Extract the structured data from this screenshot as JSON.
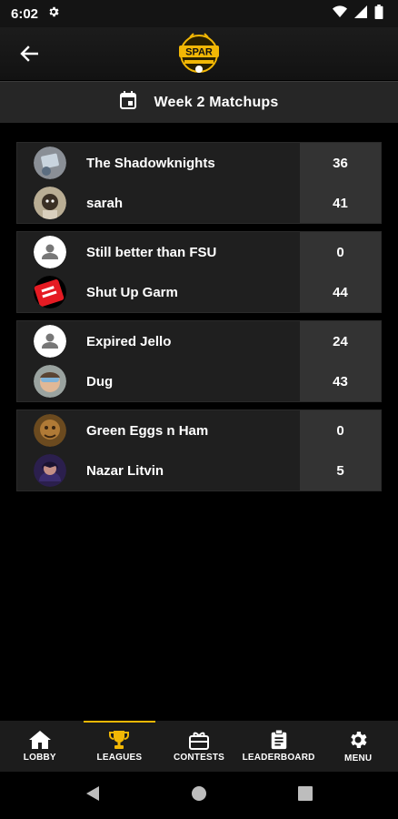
{
  "status_bar": {
    "time": "6:02"
  },
  "header": {
    "back_icon": "arrow-left-icon",
    "logo_text": "SPAR"
  },
  "subheader": {
    "title": "Week 2 Matchups",
    "icon": "calendar-icon"
  },
  "matchups": [
    {
      "home": {
        "name": "The Shadowknights",
        "score": "36"
      },
      "away": {
        "name": "sarah",
        "score": "41"
      }
    },
    {
      "home": {
        "name": "Still better than FSU",
        "score": "0"
      },
      "away": {
        "name": "Shut Up Garm",
        "score": "44"
      }
    },
    {
      "home": {
        "name": "Expired Jello",
        "score": "24"
      },
      "away": {
        "name": "Dug",
        "score": "43"
      }
    },
    {
      "home": {
        "name": "Green Eggs n Ham",
        "score": "0"
      },
      "away": {
        "name": "Nazar Litvin",
        "score": "5"
      }
    }
  ],
  "bottom_nav": [
    {
      "label": "LOBBY",
      "icon": "home-icon",
      "active": false
    },
    {
      "label": "LEAGUES",
      "icon": "trophy-icon",
      "active": true
    },
    {
      "label": "CONTESTS",
      "icon": "ticket-icon",
      "active": false
    },
    {
      "label": "LEADERBOARD",
      "icon": "clipboard-icon",
      "active": false
    },
    {
      "label": "MENU",
      "icon": "gear-icon",
      "active": false
    }
  ],
  "colors": {
    "accent": "#f2b705",
    "background": "#000000",
    "card": "#1f1f1f",
    "score_column": "#333333"
  }
}
